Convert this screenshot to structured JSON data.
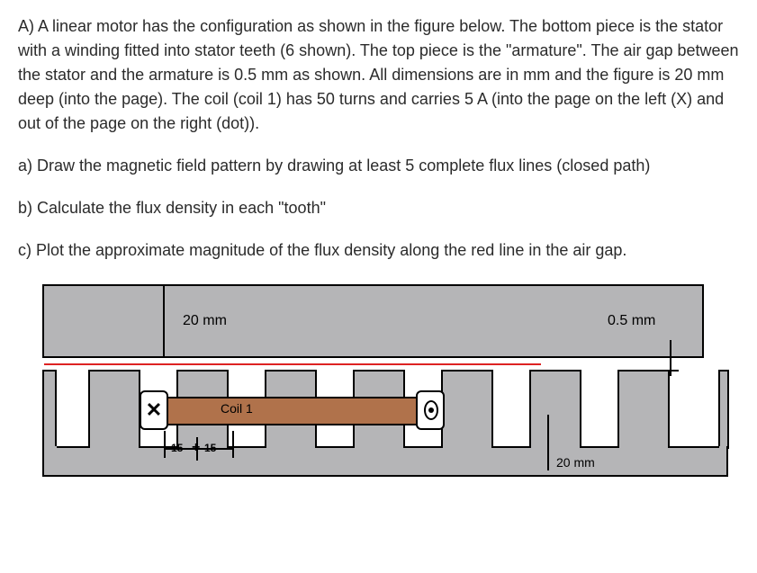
{
  "question": {
    "main": "A) A linear motor has the configuration as shown in the figure below. The bottom piece is the stator with a winding fitted into stator teeth (6 shown). The top piece is the \"armature\". The air gap between the stator and the armature is 0.5 mm as shown. All dimensions are in mm and the figure is 20 mm deep (into the page). The coil (coil 1) has 50 turns and carries 5 A (into the page on the left (X) and out of the page on the right (dot)).",
    "a": "a) Draw the magnetic field pattern by drawing at least 5 complete flux lines (closed path)",
    "b": "b) Calculate the flux density in each \"tooth\"",
    "c": "c) Plot the approximate magnitude of the flux density along the red line in the air gap."
  },
  "figure": {
    "armature_height": "20 mm",
    "airgap": "0.5 mm",
    "tooth_height": "20 mm",
    "coil_label": "Coil 1",
    "pitch_slot": "15",
    "pitch_tooth": "15"
  }
}
